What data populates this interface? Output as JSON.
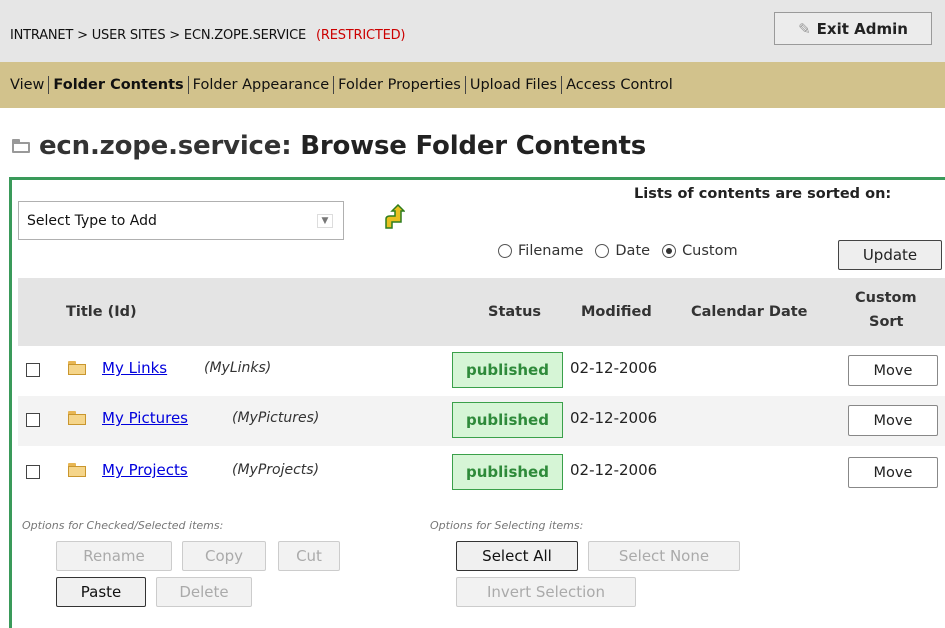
{
  "breadcrumb": {
    "path": "INTRANET > USER SITES > ECN.ZOPE.SERVICE",
    "restricted": "(RESTRICTED)"
  },
  "exit_admin": {
    "label": "Exit Admin",
    "icon": "pencil-icon"
  },
  "tabs": [
    {
      "label": "View",
      "active": false
    },
    {
      "label": "Folder Contents",
      "active": true
    },
    {
      "label": "Folder Appearance",
      "active": false
    },
    {
      "label": "Folder Properties",
      "active": false
    },
    {
      "label": "Upload Files",
      "active": false
    },
    {
      "label": "Access Control",
      "active": false
    }
  ],
  "heading": {
    "folder": "ecn.zope.service:",
    "title": "Browse Folder Contents"
  },
  "add_select": {
    "selected": "Select Type to Add"
  },
  "sort": {
    "title": "Lists of contents are sorted on:",
    "options": [
      "Filename",
      "Date",
      "Custom"
    ],
    "selected": "Custom",
    "update_label": "Update"
  },
  "table": {
    "headers": {
      "title": "Title (Id)",
      "status": "Status",
      "modified": "Modified",
      "calendar": "Calendar Date",
      "custom_sort_1": "Custom",
      "custom_sort_2": "Sort"
    },
    "rows": [
      {
        "title": "My Links",
        "id": "(MyLinks)",
        "status": "published",
        "modified": "02-12-2006",
        "calendar": "",
        "action": "Move"
      },
      {
        "title": "My Pictures",
        "id": "(MyPictures)",
        "status": "published",
        "modified": "02-12-2006",
        "calendar": "",
        "action": "Move"
      },
      {
        "title": "My Projects",
        "id": "(MyProjects)",
        "status": "published",
        "modified": "02-12-2006",
        "calendar": "",
        "action": "Move"
      }
    ]
  },
  "checked_options": {
    "label": "Options for Checked/Selected items:",
    "rename": "Rename",
    "copy": "Copy",
    "cut": "Cut",
    "paste": "Paste",
    "delete": "Delete"
  },
  "selecting_options": {
    "label": "Options for Selecting items:",
    "select_all": "Select All",
    "select_none": "Select None",
    "invert": "Invert Selection"
  },
  "colors": {
    "tabbar": "#d2c28c",
    "panel_border": "#3a9a5a",
    "status_bg": "#d6f5d6",
    "status_text": "#2e8a3a",
    "restricted": "#cc0000",
    "link": "#0000dd"
  }
}
